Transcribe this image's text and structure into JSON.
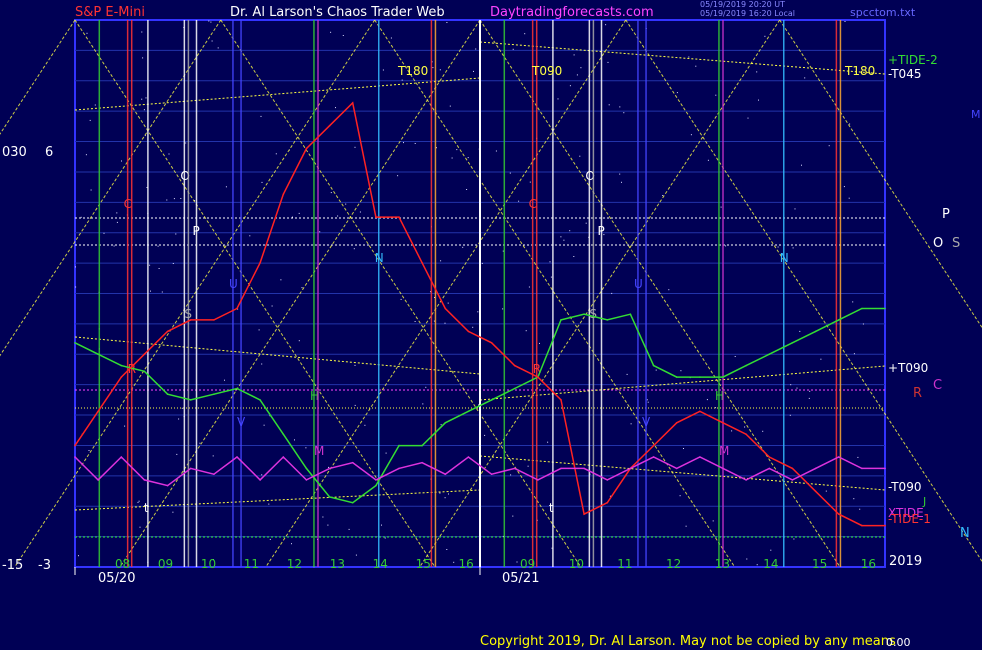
{
  "header": {
    "symbol": "S&P E-Mini",
    "author": "Dr. Al Larson's Chaos Trader Web",
    "site": "Daytradingforecasts.com",
    "stamp1": "05/19/2019 20:20 UT",
    "stamp2": "05/19/2019 16:20 Local",
    "file": "spcctom.txt"
  },
  "footer": {
    "copyright": "Copyright 2019, Dr. Al Larson. May not be copied by any means",
    "corner": "0.00"
  },
  "left_axis": {
    "top_a": "030",
    "top_b": "6",
    "bottom_a": "-15",
    "bottom_b": "-3"
  },
  "right_labels": {
    "m": "M",
    "p": "P",
    "o": "O",
    "s": "S",
    "c": "C",
    "r": "R",
    "j": "J",
    "n": "N",
    "year": "2019"
  },
  "dates": [
    "05/20",
    "05/21"
  ],
  "colors": {
    "background": "#000055",
    "plot_frame": "#3333ff",
    "grid": "#228822",
    "price": "#ff2222",
    "tide_green": "#33dd33",
    "tide_magenta": "#dd33dd",
    "grid_line": "#ffff44"
  },
  "chart_data": {
    "type": "line",
    "x_unit": "hour",
    "days": [
      {
        "date": "05/20",
        "hour_ticks": [
          "08",
          "09",
          "10",
          "11",
          "12",
          "13",
          "14",
          "15",
          "16"
        ],
        "vertical_markers": [
          "O",
          "P",
          "S",
          "U",
          "V",
          "N",
          "M",
          "H",
          "t",
          "C",
          "R"
        ],
        "line_labels": [
          "T180"
        ]
      },
      {
        "date": "05/21",
        "hour_ticks": [
          "09",
          "10",
          "11",
          "12",
          "13",
          "14",
          "15",
          "16"
        ],
        "vertical_markers": [
          "O",
          "P",
          "S",
          "U",
          "V",
          "N",
          "M",
          "H",
          "t",
          "C",
          "R"
        ],
        "line_labels": [
          "T090",
          "T180"
        ]
      }
    ],
    "right_edge_labels": [
      "+TIDE-2",
      "-T045",
      "+T090",
      "-T090",
      "XTIDE",
      "-TIDE-1"
    ],
    "series": [
      {
        "name": "+TIDE-2",
        "color": "#33dd33",
        "values": [
          9,
          8,
          7,
          6.5,
          4.5,
          4,
          4.5,
          5,
          4,
          1,
          -2,
          -4.5,
          -5,
          -3.5,
          0,
          0,
          2,
          3,
          4,
          5,
          6,
          11,
          11.5,
          11,
          11.5,
          7,
          6,
          6,
          6,
          7,
          8,
          9,
          10,
          11,
          12,
          12
        ]
      },
      {
        "name": "price",
        "color": "#ff2222",
        "values": [
          0,
          3,
          6,
          8,
          10,
          11,
          11,
          12,
          16,
          22,
          26,
          28,
          30,
          20,
          20,
          16,
          12,
          10,
          9,
          7,
          6,
          4,
          -6,
          -5,
          -2,
          0,
          2,
          3,
          2,
          1,
          -1,
          -2,
          -4,
          -6,
          -7,
          -7
        ]
      },
      {
        "name": "-TIDE-1",
        "color": "#dd33dd",
        "values": [
          -1,
          -3,
          -1,
          -3,
          -3.5,
          -2,
          -2.5,
          -1,
          -3,
          -1,
          -3,
          -2,
          -1.5,
          -3,
          -2,
          -1.5,
          -2.5,
          -1,
          -2.5,
          -2,
          -3,
          -2,
          -2,
          -3,
          -2,
          -1,
          -2,
          -1,
          -2,
          -3,
          -2,
          -3,
          -2,
          -1,
          -2,
          -2
        ]
      }
    ]
  }
}
